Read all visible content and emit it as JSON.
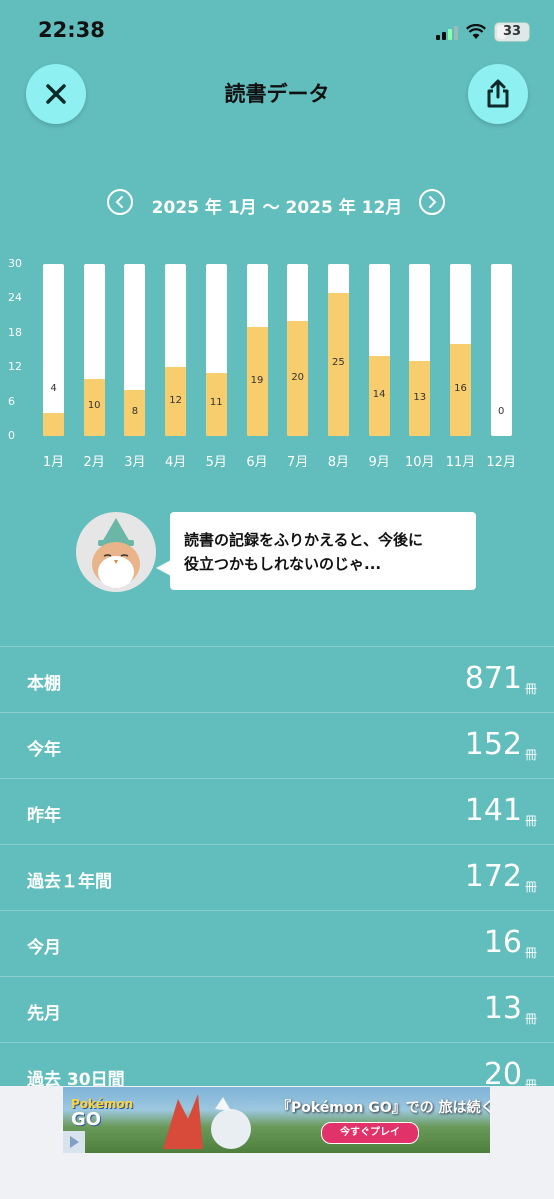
{
  "status_bar": {
    "time": "22:38",
    "battery": "33"
  },
  "header": {
    "title": "読書データ"
  },
  "range": {
    "text": "2025 年 1月 〜 2025 年 12月"
  },
  "chart_data": {
    "type": "bar",
    "categories": [
      "1月",
      "2月",
      "3月",
      "4月",
      "5月",
      "6月",
      "7月",
      "8月",
      "9月",
      "10月",
      "11月",
      "12月"
    ],
    "values": [
      4,
      10,
      8,
      12,
      11,
      19,
      20,
      25,
      14,
      13,
      16,
      0
    ],
    "y_ticks": [
      "30",
      "24",
      "18",
      "12",
      "6",
      "0"
    ],
    "ylim": [
      0,
      30
    ],
    "colors": {
      "fill": "#f7cd6e",
      "track": "#ffffff"
    }
  },
  "bubble": {
    "line1": "読書の記録をふりかえると、今後に",
    "line2": "役立つかもしれないのじゃ..."
  },
  "stats": [
    {
      "label": "本棚",
      "value": "871",
      "unit": "冊"
    },
    {
      "label": "今年",
      "value": "152",
      "unit": "冊"
    },
    {
      "label": "昨年",
      "value": "141",
      "unit": "冊"
    },
    {
      "label": "過去１年間",
      "value": "172",
      "unit": "冊"
    },
    {
      "label": "今月",
      "value": "16",
      "unit": "冊"
    },
    {
      "label": "先月",
      "value": "13",
      "unit": "冊"
    },
    {
      "label": "過去 30日間",
      "value": "20",
      "unit": "冊"
    }
  ],
  "ad": {
    "logo_top": "Pokémon",
    "logo_bottom": "GO",
    "headline": "『Pokémon GO』での 旅は続く",
    "cta": "今すぐプレイ"
  }
}
